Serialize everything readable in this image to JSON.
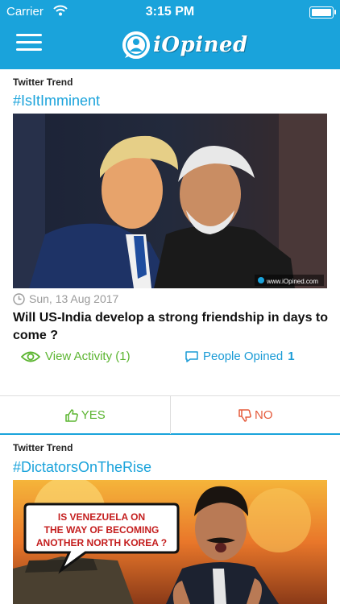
{
  "status_bar": {
    "carrier": "Carrier",
    "time": "3:15 PM"
  },
  "header": {
    "logo_text": "iOpined",
    "icons": [
      "menu-icon",
      "iopined-logo-icon"
    ]
  },
  "colors": {
    "brand": "#1aa3db",
    "yes": "#5cb531",
    "no": "#e55b3c",
    "link": "#1a9bd6"
  },
  "cards": [
    {
      "trend_label": "Twitter Trend",
      "hashtag": "#IsItImminent",
      "image_watermark": "www.iOpined.com",
      "date": "Sun, 13 Aug 2017",
      "question": "Will US-India develop a strong friendship in days to come ?",
      "view_activity": "View Activity (1)",
      "people_opined_label": "People Opined",
      "people_opined_count": "1",
      "yes_label": "YES",
      "no_label": "NO"
    },
    {
      "trend_label": "Twitter Trend",
      "hashtag": "#DictatorsOnTheRise",
      "image_caption": "IS VENEZUELA ON THE WAY OF BECOMING ANOTHER NORTH KOREA ?"
    }
  ]
}
